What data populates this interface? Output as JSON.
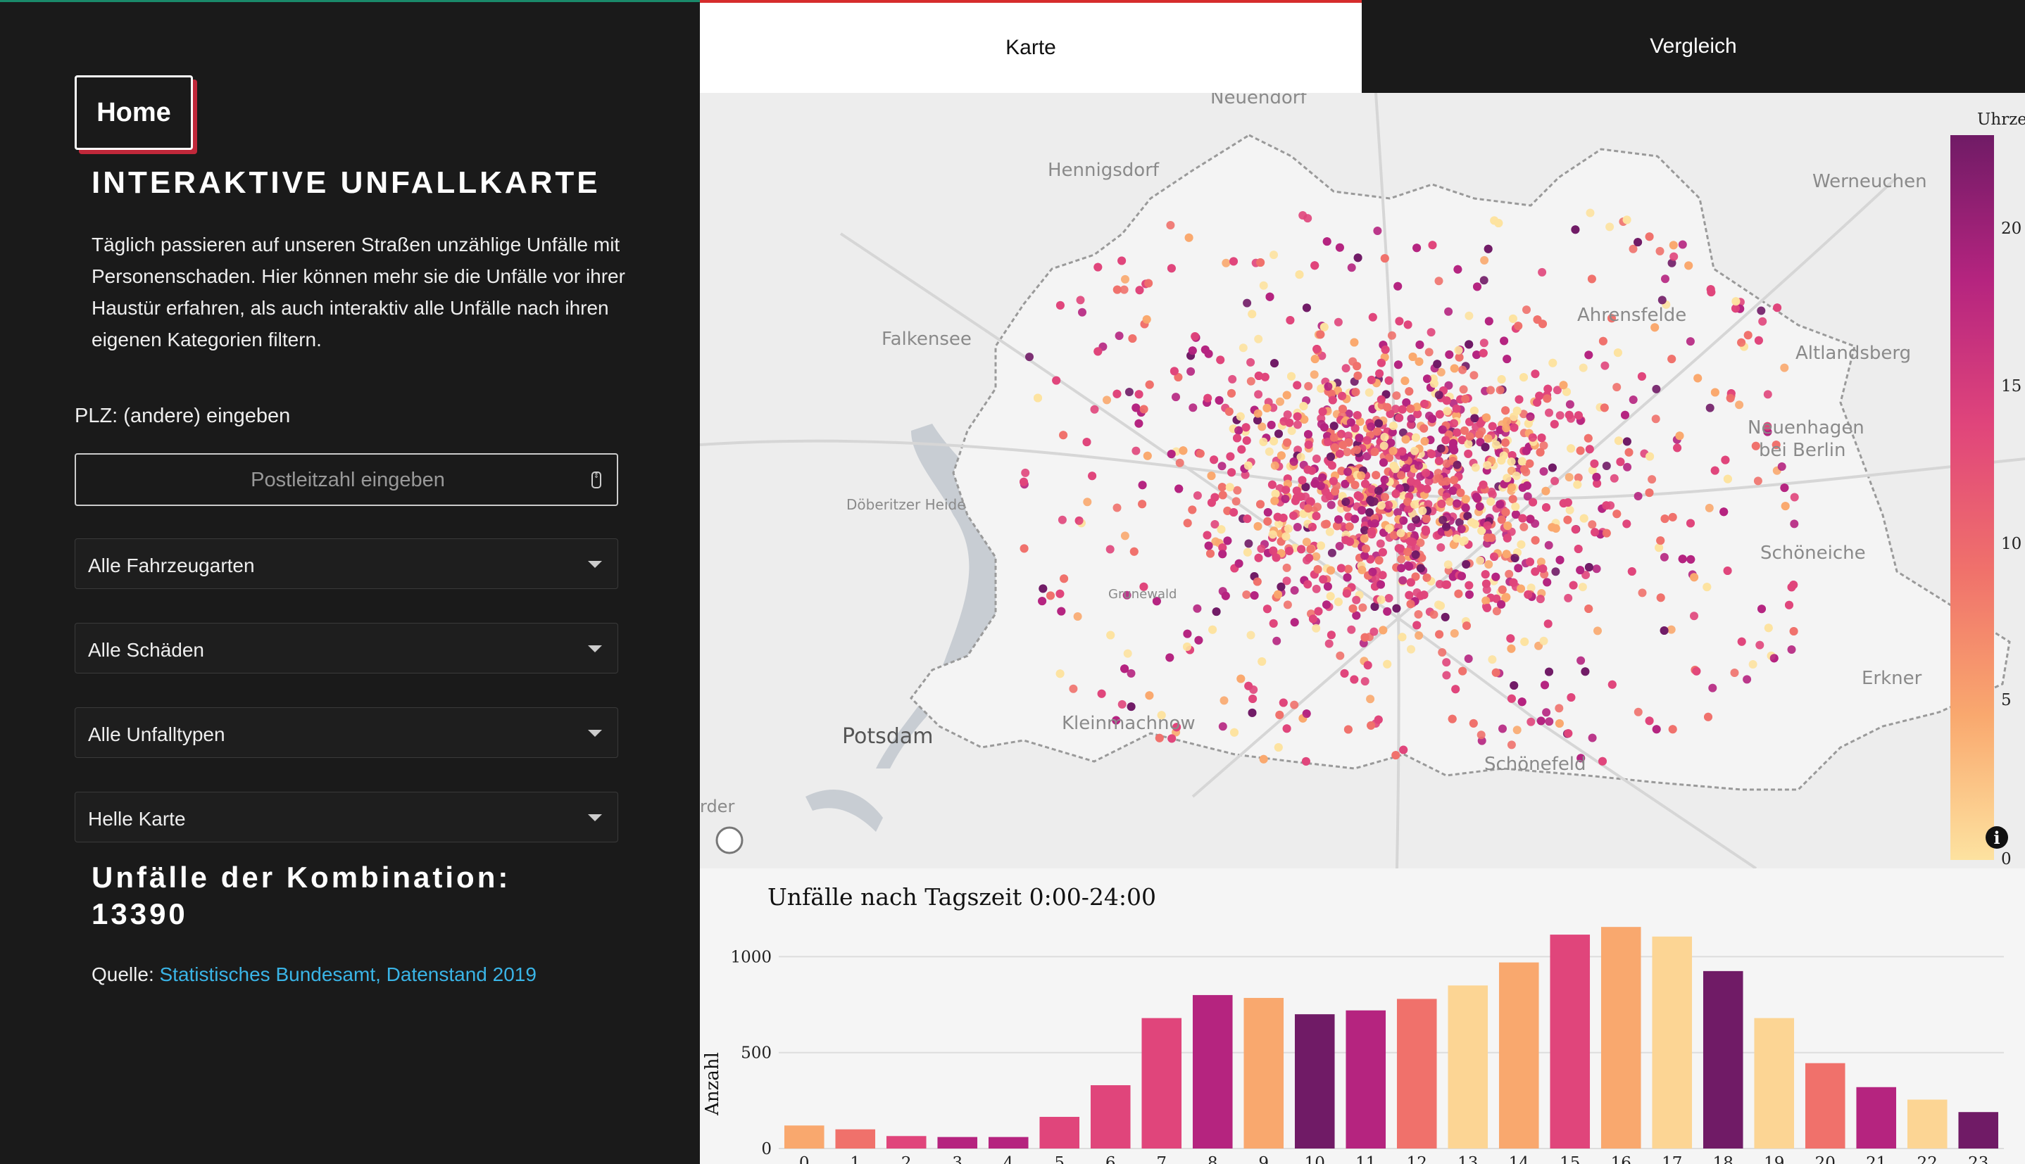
{
  "sidebar": {
    "home_label": "Home",
    "title": "INTERAKTIVE UNFALLKARTE",
    "intro": "Täglich passieren auf unseren Straßen unzählige Unfälle mit Personenschaden. Hier können mehr sie die Unfälle vor ihrer Haustür erfahren, als auch interaktiv alle Unfälle nach ihren eigenen Kategorien filtern.",
    "plz_label": "PLZ: (andere) eingeben",
    "plz_placeholder": "Postleitzahl eingeben",
    "plz_value": "",
    "dropdowns": {
      "vehicle": "Alle Fahrzeugarten",
      "damage": "Alle Schäden",
      "accident_type": "Alle Unfalltypen",
      "map_style": "Helle Karte"
    },
    "count_label": "Unfälle der Kombination:",
    "count_value": "13390",
    "source_prefix": "Quelle: ",
    "source_link": "Statistisches Bundesamt, Datenstand 2019"
  },
  "tabs": {
    "karte": "Karte",
    "vergleich": "Vergleich",
    "active": "Karte"
  },
  "map": {
    "place_labels": [
      "Neuendorf",
      "Hennigsdorf",
      "Werneuchen",
      "Ahrensfelde",
      "Falkensee",
      "Altlandsberg",
      "Neuenhagen",
      "bei Berlin",
      "Döberitzer Heide",
      "Schöneiche",
      "Grunewald",
      "Erkner",
      "Potsdam",
      "Kleinmachnow",
      "Schönefeld",
      "rder"
    ],
    "colorbar": {
      "title": "Uhrzeit",
      "ticks": [
        "20",
        "15",
        "10",
        "5",
        "0"
      ],
      "range": [
        0,
        23
      ],
      "colors": [
        "#fde2a0",
        "#f9a86e",
        "#f0716b",
        "#e0457b",
        "#b5247f",
        "#701b66"
      ]
    },
    "info_icon": "info-icon",
    "zoom_icon": "map-logo-icon"
  },
  "chart_data": {
    "type": "bar",
    "title": "Unfälle nach Tagszeit 0:00-24:00",
    "ylabel": "Anzahl",
    "xlabel": "",
    "categories": [
      "0",
      "1",
      "2",
      "3",
      "4",
      "5",
      "6",
      "7",
      "8",
      "9",
      "10",
      "11",
      "12",
      "13",
      "14",
      "15",
      "16",
      "17",
      "18",
      "19",
      "20",
      "21",
      "22",
      "23"
    ],
    "values": [
      120,
      100,
      65,
      60,
      60,
      165,
      330,
      680,
      800,
      785,
      700,
      720,
      780,
      850,
      970,
      1115,
      1155,
      1105,
      925,
      680,
      445,
      320,
      255,
      190
    ],
    "ylim": [
      0,
      1240
    ],
    "yticks": [
      "0",
      "500",
      "1000"
    ],
    "grid": true,
    "bar_colors": [
      "#f9a86e",
      "#f0716b",
      "#e0457b",
      "#b5247f",
      "#b5247f",
      "#e0457b",
      "#e0457b",
      "#e0457b",
      "#b5247f",
      "#f9a86e",
      "#701b66",
      "#b5247f",
      "#f0716b",
      "#fcd594",
      "#f9a86e",
      "#e0457b",
      "#f9a86e",
      "#fcd594",
      "#701b66",
      "#fcd594",
      "#f0716b",
      "#b5247f",
      "#fcd594",
      "#701b66"
    ]
  }
}
